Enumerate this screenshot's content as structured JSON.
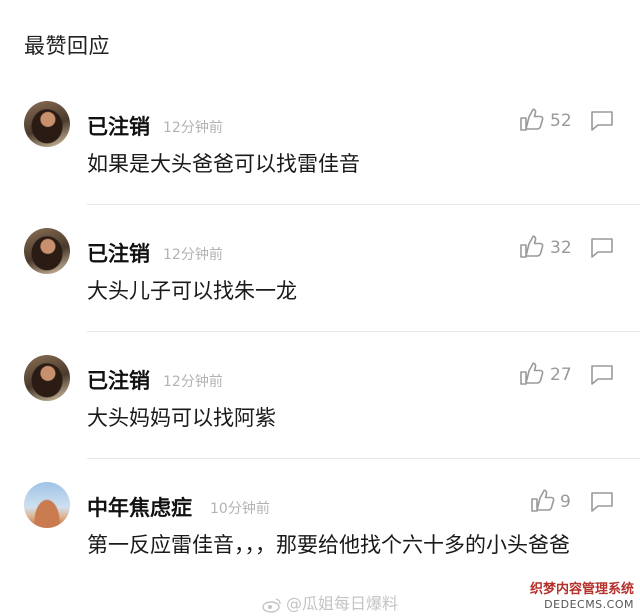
{
  "section_title": "最赞回应",
  "comments": [
    {
      "author": "已注销",
      "time": "12分钟前",
      "text": "如果是大头爸爸可以找雷佳音",
      "likes": "52"
    },
    {
      "author": "已注销",
      "time": "12分钟前",
      "text": "大头儿子可以找朱一龙",
      "likes": "32"
    },
    {
      "author": "已注销",
      "time": "12分钟前",
      "text": "大头妈妈可以找阿紫",
      "likes": "27"
    },
    {
      "author": "中年焦虑症",
      "time": "10分钟前",
      "text": "第一反应雷佳音，，，那要给他找个六十多的小头爸爸",
      "likes": "9"
    }
  ],
  "watermark": "@瓜姐每日爆料",
  "site_badge": {
    "line1": "织梦内容管理系统",
    "line2": "DEDECMS.COM"
  },
  "icons": {
    "like": "thumbs-up-icon",
    "reply": "comment-bubble-icon",
    "weibo": "weibo-logo-icon"
  },
  "colors": {
    "muted": "#b3b3b3",
    "divider": "#e6e6e6"
  }
}
